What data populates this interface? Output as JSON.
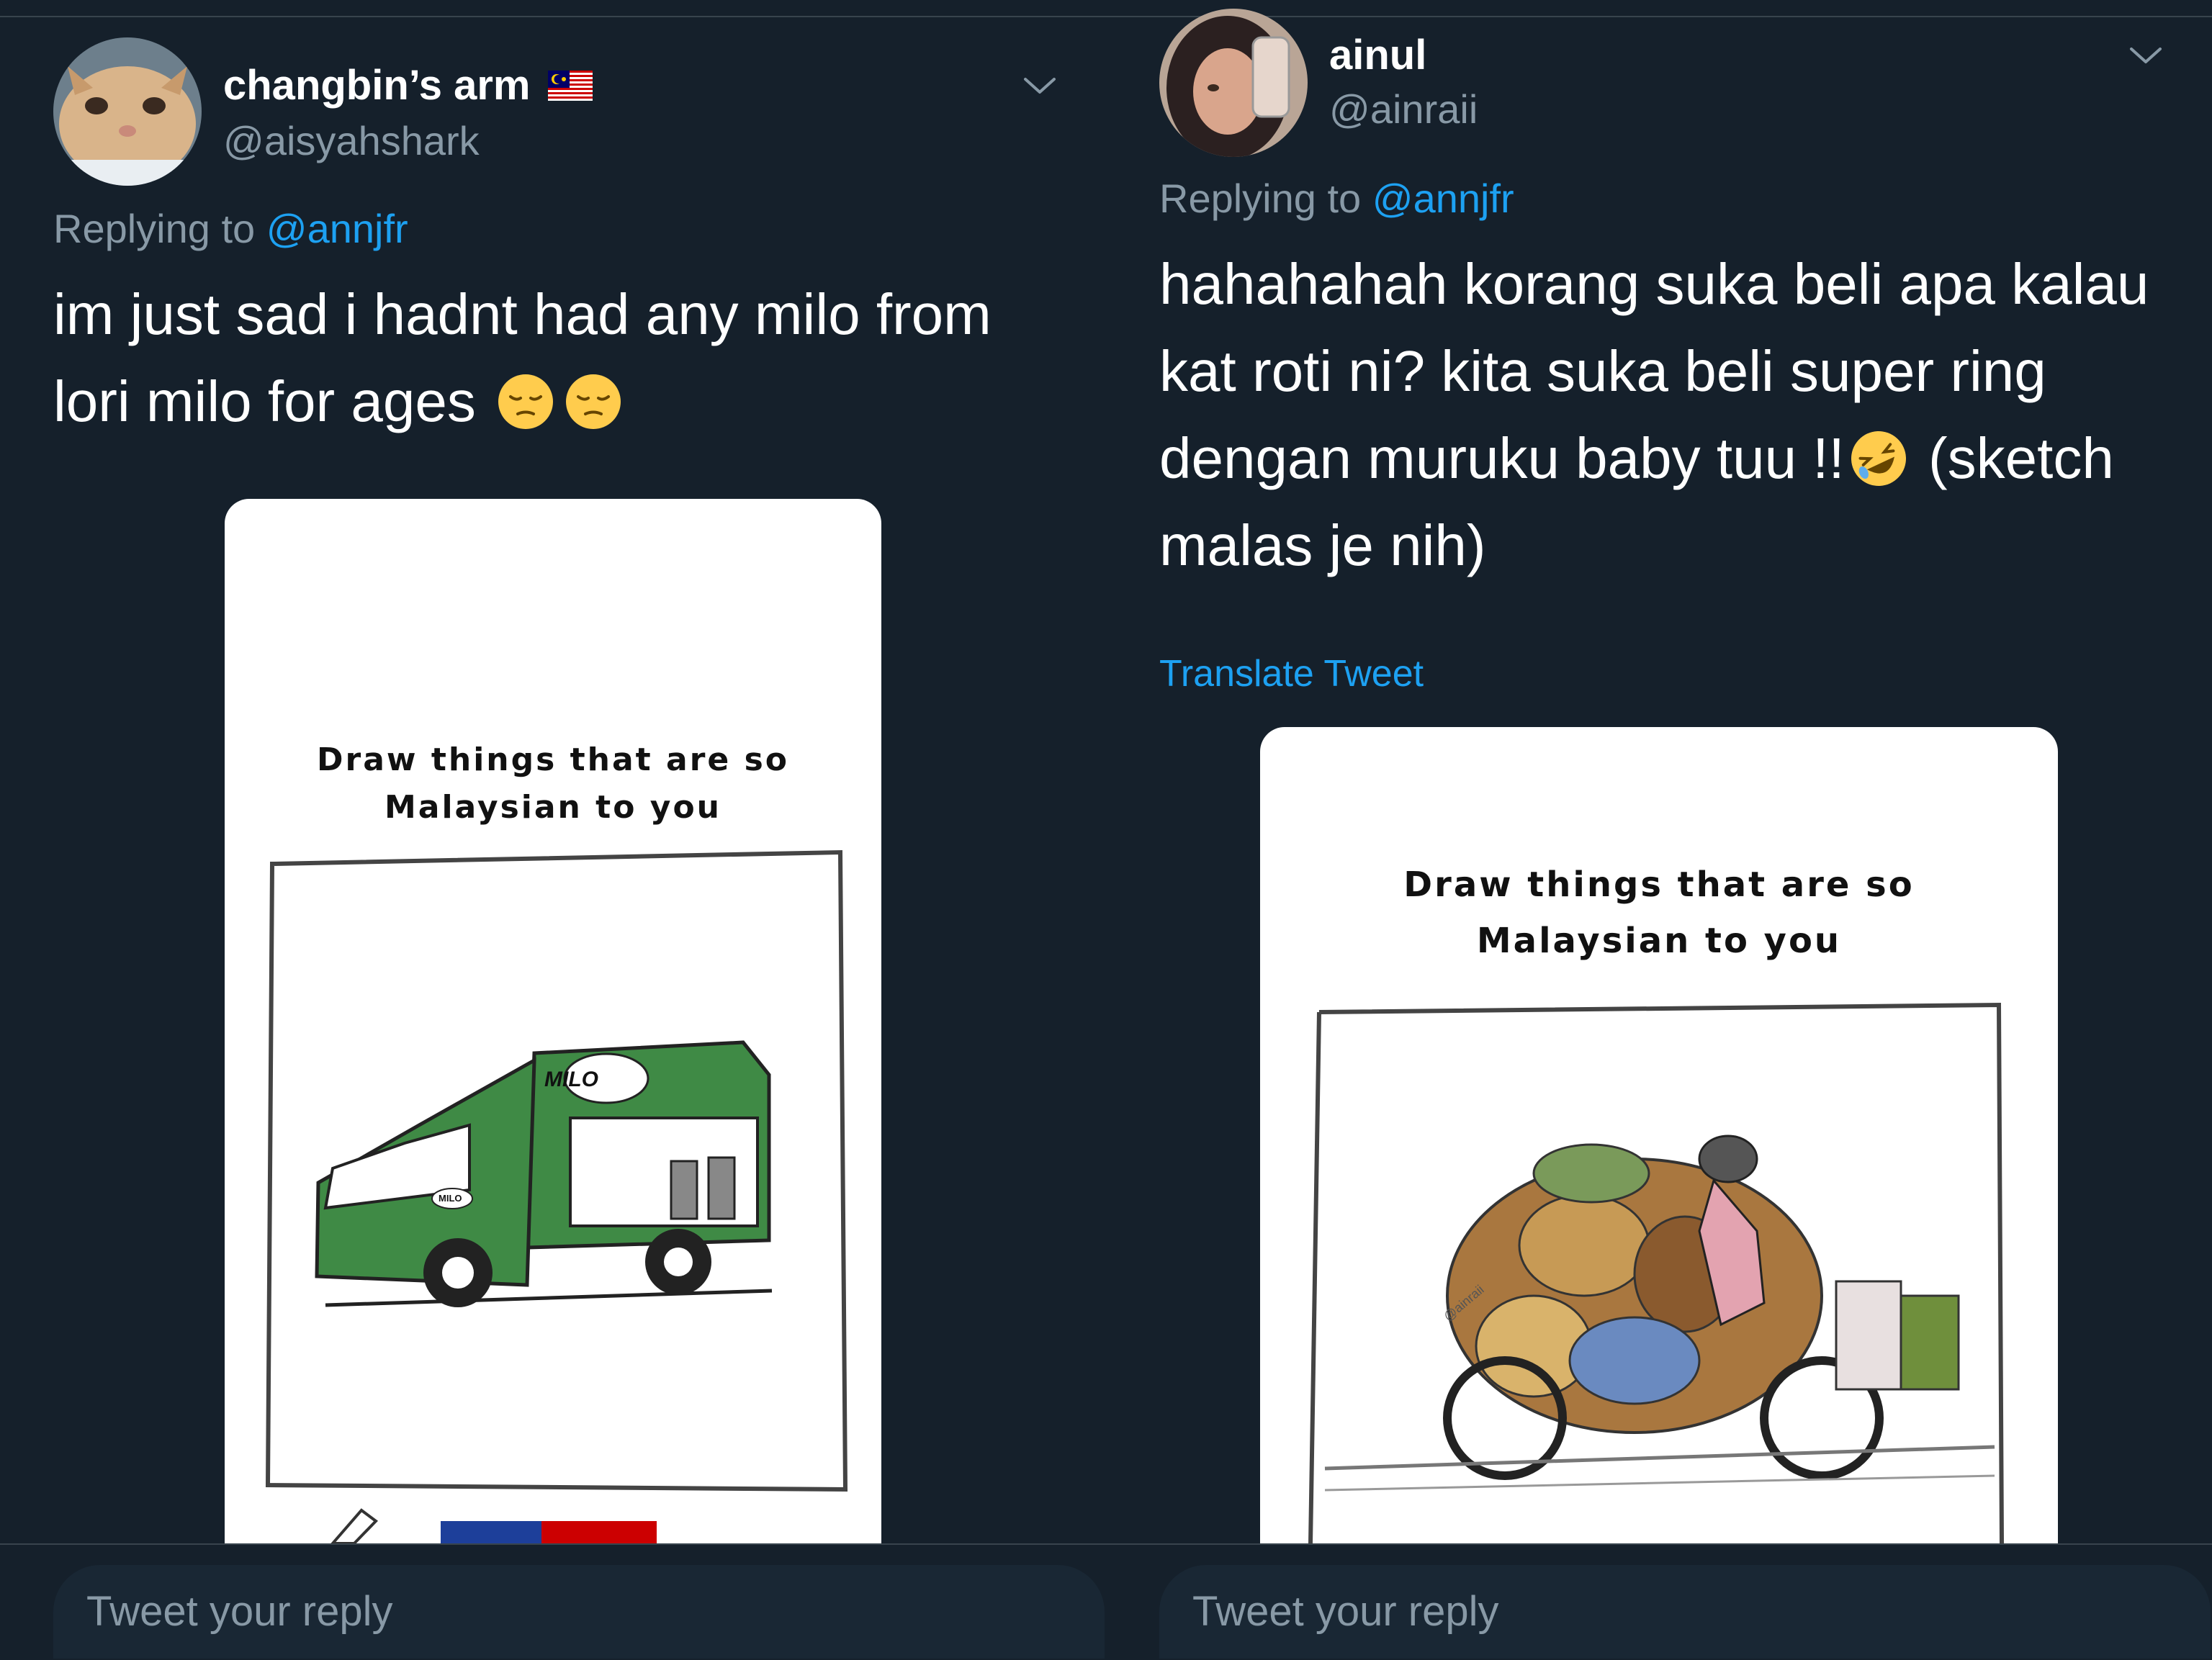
{
  "left_tweet": {
    "display_name": "changbin’s arm",
    "handle": "@aisyahshark",
    "replying_prefix": "Replying to",
    "replying_to": "@annjfr",
    "text": "im just sad i hadnt had any milo from lori milo for ages",
    "emojis": [
      "pensive-face",
      "pensive-face"
    ],
    "image": {
      "title_line1": "Draw things that are so",
      "title_line2": "Malaysian to you",
      "truck_brand": "MILO",
      "truck_small_brand": "MILO"
    }
  },
  "right_tweet": {
    "display_name": "ainul",
    "handle": "@ainraii",
    "replying_prefix": "Replying to",
    "replying_to": "@annjfr",
    "text_before_emoji": "hahahahah korang suka beli apa kalau kat roti ni? kita suka beli super ring dengan muruku baby tuu !!",
    "emoji": "rolling-on-floor-laughing",
    "text_after_emoji": " (sketch malas je nih)",
    "translate_label": "Translate Tweet",
    "image": {
      "title_line1": "Draw things that are so",
      "title_line2": "Malaysian to you",
      "signature": "@ainraii"
    }
  },
  "reply_bar": {
    "placeholder_left": "Tweet your reply",
    "placeholder_right": "Tweet your reply"
  },
  "colors": {
    "background": "#15202b",
    "secondary_text": "#8899a6",
    "link": "#1da1f2",
    "truck_green": "#3f8a45"
  }
}
